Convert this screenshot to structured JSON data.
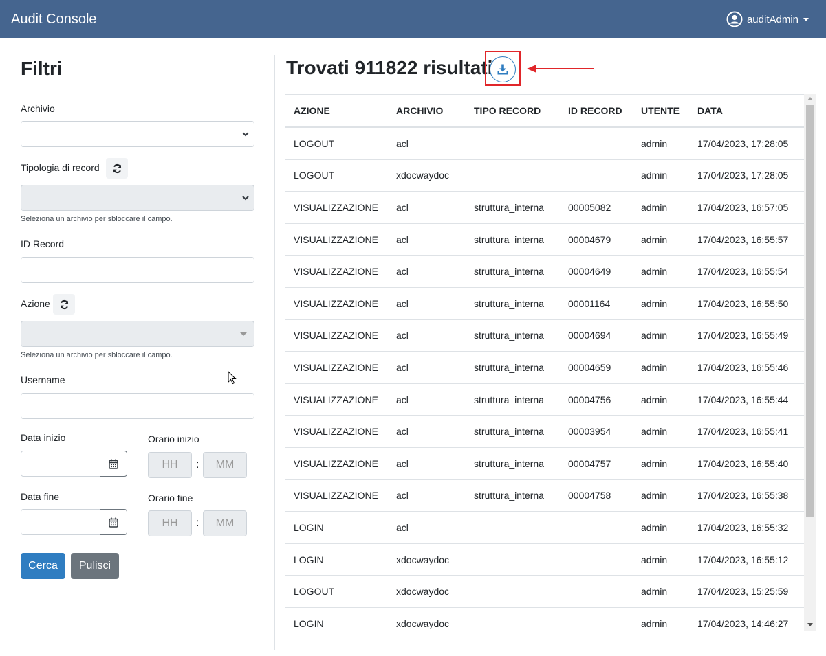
{
  "navbar": {
    "brand": "Audit Console",
    "user": "auditAdmin",
    "user_icon": "user-circle-icon"
  },
  "filters": {
    "title": "Filtri",
    "archivio_label": "Archivio",
    "tipologia_label": "Tipologia di record",
    "tipologia_help": "Seleziona un archivio per sbloccare il campo.",
    "id_record_label": "ID Record",
    "azione_label": "Azione",
    "azione_help": "Seleziona un archivio per sbloccare il campo.",
    "username_label": "Username",
    "data_inizio_label": "Data inizio",
    "orario_inizio_label": "Orario inizio",
    "data_fine_label": "Data fine",
    "orario_fine_label": "Orario fine",
    "hh_placeholder": "HH",
    "mm_placeholder": "MM",
    "colon": ":",
    "search_button": "Cerca",
    "clear_button": "Pulisci"
  },
  "results": {
    "title": "Trovati 911822 risultati",
    "columns": [
      "AZIONE",
      "ARCHIVIO",
      "TIPO RECORD",
      "ID RECORD",
      "UTENTE",
      "DATA"
    ],
    "rows": [
      [
        "LOGOUT",
        "acl",
        "",
        "",
        "admin",
        "17/04/2023, 17:28:05"
      ],
      [
        "LOGOUT",
        "xdocwaydoc",
        "",
        "",
        "admin",
        "17/04/2023, 17:28:05"
      ],
      [
        "VISUALIZZAZIONE",
        "acl",
        "struttura_interna",
        "00005082",
        "admin",
        "17/04/2023, 16:57:05"
      ],
      [
        "VISUALIZZAZIONE",
        "acl",
        "struttura_interna",
        "00004679",
        "admin",
        "17/04/2023, 16:55:57"
      ],
      [
        "VISUALIZZAZIONE",
        "acl",
        "struttura_interna",
        "00004649",
        "admin",
        "17/04/2023, 16:55:54"
      ],
      [
        "VISUALIZZAZIONE",
        "acl",
        "struttura_interna",
        "00001164",
        "admin",
        "17/04/2023, 16:55:50"
      ],
      [
        "VISUALIZZAZIONE",
        "acl",
        "struttura_interna",
        "00004694",
        "admin",
        "17/04/2023, 16:55:49"
      ],
      [
        "VISUALIZZAZIONE",
        "acl",
        "struttura_interna",
        "00004659",
        "admin",
        "17/04/2023, 16:55:46"
      ],
      [
        "VISUALIZZAZIONE",
        "acl",
        "struttura_interna",
        "00004756",
        "admin",
        "17/04/2023, 16:55:44"
      ],
      [
        "VISUALIZZAZIONE",
        "acl",
        "struttura_interna",
        "00003954",
        "admin",
        "17/04/2023, 16:55:41"
      ],
      [
        "VISUALIZZAZIONE",
        "acl",
        "struttura_interna",
        "00004757",
        "admin",
        "17/04/2023, 16:55:40"
      ],
      [
        "VISUALIZZAZIONE",
        "acl",
        "struttura_interna",
        "00004758",
        "admin",
        "17/04/2023, 16:55:38"
      ],
      [
        "LOGIN",
        "acl",
        "",
        "",
        "admin",
        "17/04/2023, 16:55:32"
      ],
      [
        "LOGIN",
        "xdocwaydoc",
        "",
        "",
        "admin",
        "17/04/2023, 16:55:12"
      ],
      [
        "LOGOUT",
        "xdocwaydoc",
        "",
        "",
        "admin",
        "17/04/2023, 15:25:59"
      ],
      [
        "LOGIN",
        "xdocwaydoc",
        "",
        "",
        "admin",
        "17/04/2023, 14:46:27"
      ]
    ]
  },
  "colors": {
    "navbar": "#45658f",
    "primary": "#2f7dc1",
    "secondary": "#6c757d",
    "highlight": "#e0262a"
  }
}
